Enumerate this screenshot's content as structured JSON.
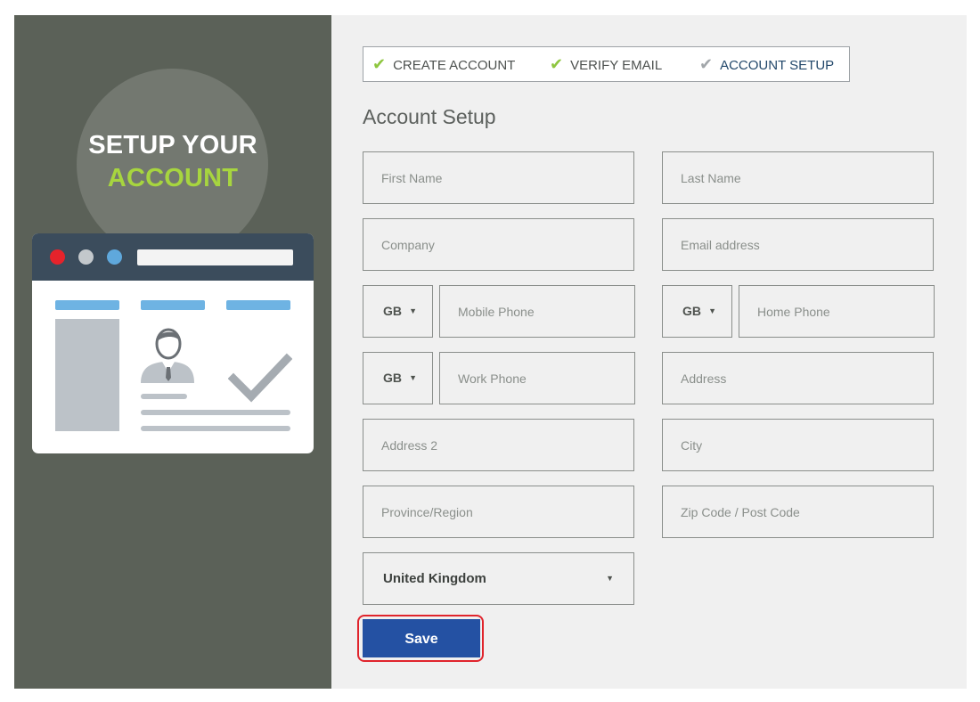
{
  "hero": {
    "line1": "SETUP YOUR",
    "line2": "ACCOUNT"
  },
  "steps": [
    {
      "label": "CREATE ACCOUNT",
      "state": "done"
    },
    {
      "label": "VERIFY EMAIL",
      "state": "done"
    },
    {
      "label": "ACCOUNT SETUP",
      "state": "current"
    }
  ],
  "form": {
    "heading": "Account Setup",
    "first_name": {
      "placeholder": "First Name"
    },
    "last_name": {
      "placeholder": "Last Name"
    },
    "company": {
      "placeholder": "Company"
    },
    "email": {
      "placeholder": "Email address"
    },
    "mobile_code": "GB",
    "mobile_phone": {
      "placeholder": "Mobile Phone"
    },
    "home_code": "GB",
    "home_phone": {
      "placeholder": "Home Phone"
    },
    "work_code": "GB",
    "work_phone": {
      "placeholder": "Work Phone"
    },
    "address": {
      "placeholder": "Address"
    },
    "address2": {
      "placeholder": "Address 2"
    },
    "city": {
      "placeholder": "City"
    },
    "province": {
      "placeholder": "Province/Region"
    },
    "zip": {
      "placeholder": "Zip Code / Post Code"
    },
    "country": "United Kingdom",
    "save_label": "Save"
  },
  "colors": {
    "accent_green": "#a7d53f",
    "primary_blue": "#2451a3",
    "sidebar_bg": "#5b6158",
    "highlight_red": "#e0242c"
  },
  "icons": {
    "check": "check-icon",
    "caret": "caret-down-icon"
  }
}
